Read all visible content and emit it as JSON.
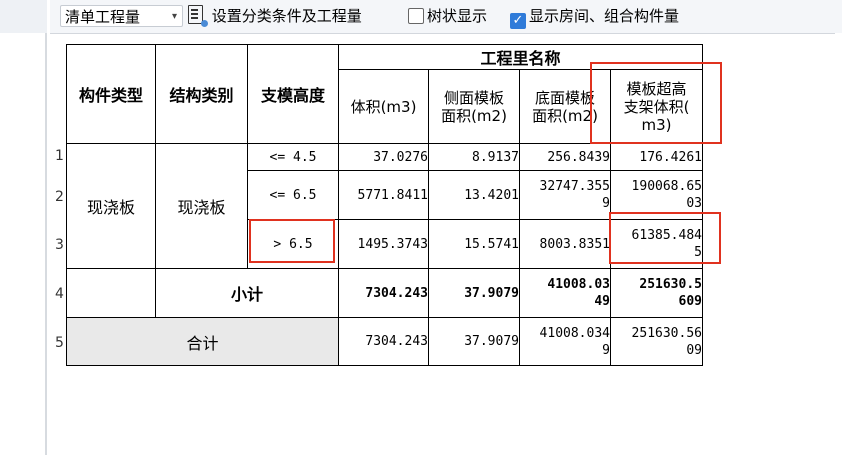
{
  "toolbar": {
    "dropdown_value": "清单工程量",
    "dropdown_arrow": "▾",
    "settings_label": "设置分类条件及工程量",
    "tree_display_label": "树状显示",
    "tree_display_checked": false,
    "show_room_label": "显示房间、组合构件量",
    "show_room_checked": true
  },
  "table": {
    "headers": {
      "component_type": "构件类型",
      "structure_category": "结构类别",
      "support_height": "支模高度",
      "quantity_name": "工程里名称",
      "volume": "体积(m3)",
      "side_formwork_l1": "侧面模板",
      "side_formwork_l2": "面积(m2)",
      "bottom_formwork_l1": "底面模板",
      "bottom_formwork_l2": "面积(m2)",
      "tall_support_l1": "模板超高",
      "tall_support_l2": "支架体积(",
      "tall_support_l3": "m3)"
    },
    "row_numbers": [
      "1",
      "2",
      "3",
      "4",
      "5"
    ],
    "component_type": "现浇板",
    "structure_category": "现浇板",
    "rows": [
      {
        "height": "<= 4.5",
        "volume": "37.0276",
        "side": "8.9137",
        "bottom": "256.8439",
        "tall": "176.4261"
      },
      {
        "height": "<= 6.5",
        "volume": "5771.8411",
        "side": "13.4201",
        "bottom_l1": "32747.355",
        "bottom_l2": "9",
        "tall_l1": "190068.65",
        "tall_l2": "03"
      },
      {
        "height": "> 6.5",
        "volume": "1495.3743",
        "side": "15.5741",
        "bottom": "8003.8351",
        "tall_l1": "61385.484",
        "tall_l2": "5"
      }
    ],
    "subtotal": {
      "label": "小计",
      "volume": "7304.243",
      "side": "37.9079",
      "bottom_l1": "41008.03",
      "bottom_l2": "49",
      "tall_l1": "251630.5",
      "tall_l2": "609"
    },
    "total": {
      "label": "合计",
      "volume": "7304.243",
      "side": "37.9079",
      "bottom_l1": "41008.034",
      "bottom_l2": "9",
      "tall_l1": "251630.56",
      "tall_l2": "09"
    }
  },
  "colors": {
    "highlight_box": "#e0321f",
    "checkbox_checked": "#2f7bd9",
    "total_row_bg": "#e9e9e9"
  }
}
